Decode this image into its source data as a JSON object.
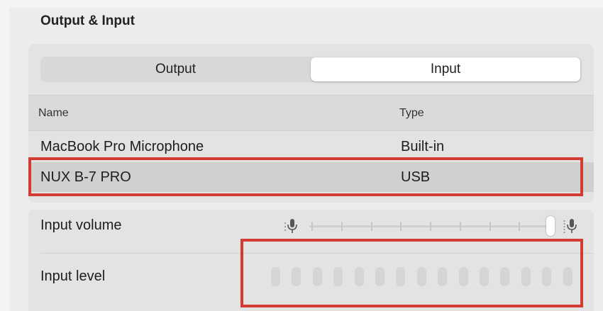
{
  "section": {
    "title": "Output & Input"
  },
  "tabs": [
    {
      "label": "Output",
      "selected": false
    },
    {
      "label": "Input",
      "selected": true
    }
  ],
  "table": {
    "columns": [
      "Name",
      "Type"
    ],
    "rows": [
      {
        "name": "MacBook Pro Microphone",
        "type": "Built-in",
        "selected": false
      },
      {
        "name": "NUX B-7 PRO",
        "type": "USB",
        "selected": true
      }
    ]
  },
  "input_volume": {
    "label": "Input volume",
    "value": 1.0,
    "tick_count": 9,
    "icon_left": "microphone-low-icon",
    "icon_right": "microphone-high-icon"
  },
  "input_level": {
    "label": "Input level",
    "segments": 15,
    "active_segments": 0
  },
  "colors": {
    "highlight": "#d33b32",
    "selected_row": "#d0d0d0"
  }
}
